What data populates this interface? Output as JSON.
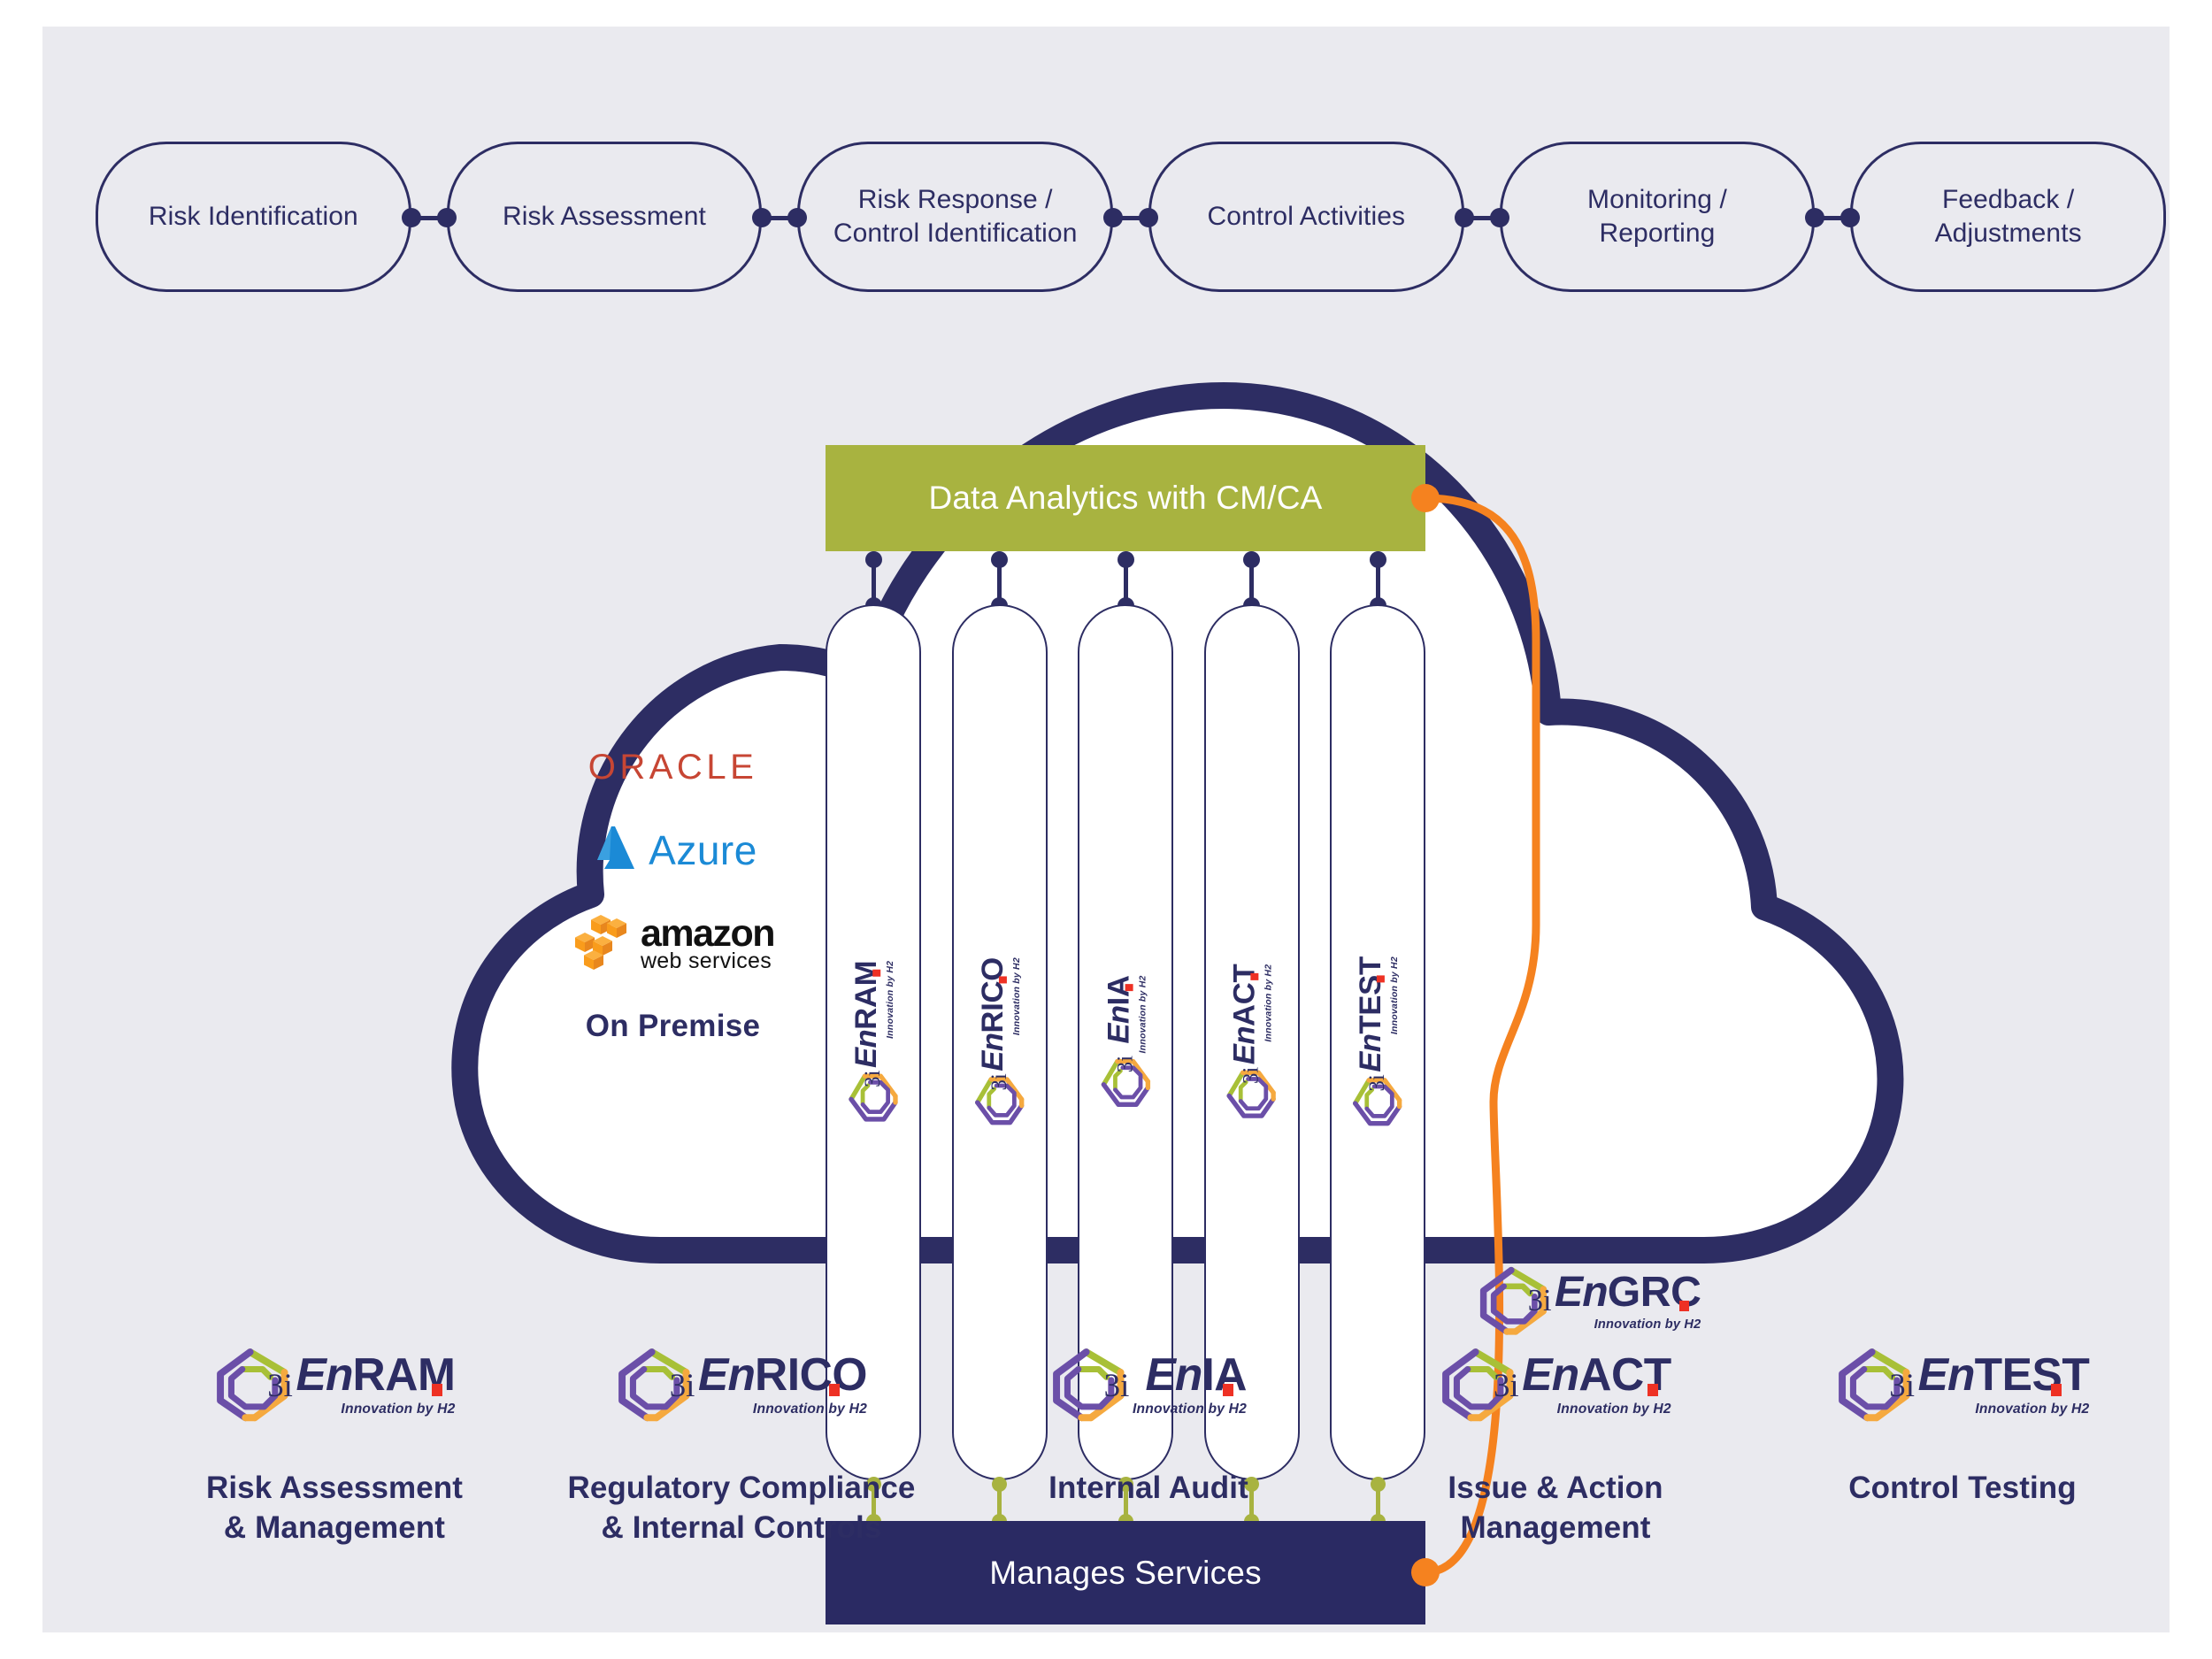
{
  "canvas": {
    "background": "#eaeaef"
  },
  "colors": {
    "navy": "#2d2d63",
    "navy_bar": "#2a2a63",
    "green": "#a8b340",
    "orange": "#f5821f",
    "logo_purple": "#6b4fa8",
    "logo_green": "#a8c037",
    "logo_orange": "#f5a93f",
    "logo_red": "#ee3124",
    "oracle_red": "#c74634",
    "azure_blue": "#1b8ad6",
    "aws_orange": "#f99c1c"
  },
  "pipeline": {
    "name": "risk-management-lifecycle",
    "steps": [
      {
        "label": "Risk Identification"
      },
      {
        "label": "Risk Assessment"
      },
      {
        "label": "Risk Response /\nControl Identification"
      },
      {
        "label": "Control Activities"
      },
      {
        "label": "Monitoring /\nReporting"
      },
      {
        "label": "Feedback /\nAdjustments"
      }
    ]
  },
  "cloud": {
    "top_bar": {
      "label": "Data Analytics with CM/CA",
      "color": "#a8b340"
    },
    "bottom_bar": {
      "label": "Manages Services",
      "color": "#2a2a63"
    },
    "platforms": [
      {
        "name": "oracle",
        "label": "ORACLE"
      },
      {
        "name": "azure",
        "label": "Azure"
      },
      {
        "name": "aws",
        "label": "amazon",
        "sub_label": "web services"
      },
      {
        "name": "on-premise",
        "label": "On Premise"
      }
    ],
    "pills": [
      {
        "brand": "En",
        "accent": "RAM",
        "tagline": "Innovation by H2",
        "prefix": "3i"
      },
      {
        "brand": "En",
        "accent": "RICO",
        "tagline": "Innovation by H2",
        "prefix": "3i"
      },
      {
        "brand": "En",
        "accent": "IA",
        "tagline": "Innovation by H2",
        "prefix": "3i"
      },
      {
        "brand": "En",
        "accent": "ACT",
        "tagline": "Innovation by H2",
        "prefix": "3i"
      },
      {
        "brand": "En",
        "accent": "TEST",
        "tagline": "Innovation by H2",
        "prefix": "3i"
      }
    ],
    "engrc": {
      "prefix": "3i",
      "brand": "En",
      "accent": "GRC",
      "tagline": "Innovation by H2"
    }
  },
  "products": [
    {
      "prefix": "3i",
      "brand": "En",
      "accent": "RAM",
      "tagline": "Innovation by H2",
      "caption": "Risk Assessment\n& Management"
    },
    {
      "prefix": "3i",
      "brand": "En",
      "accent": "RICO",
      "tagline": "Innovation by H2",
      "caption": "Regulatory Compliance\n& Internal Controls"
    },
    {
      "prefix": "3i",
      "brand": "En",
      "accent": "IA",
      "tagline": "Innovation by H2",
      "caption": "Internal Audit"
    },
    {
      "prefix": "3i",
      "brand": "En",
      "accent": "ACT",
      "tagline": "Innovation by H2",
      "caption": "Issue & Action\nManagement"
    },
    {
      "prefix": "3i",
      "brand": "En",
      "accent": "TEST",
      "tagline": "Innovation by H2",
      "caption": "Control Testing"
    }
  ]
}
